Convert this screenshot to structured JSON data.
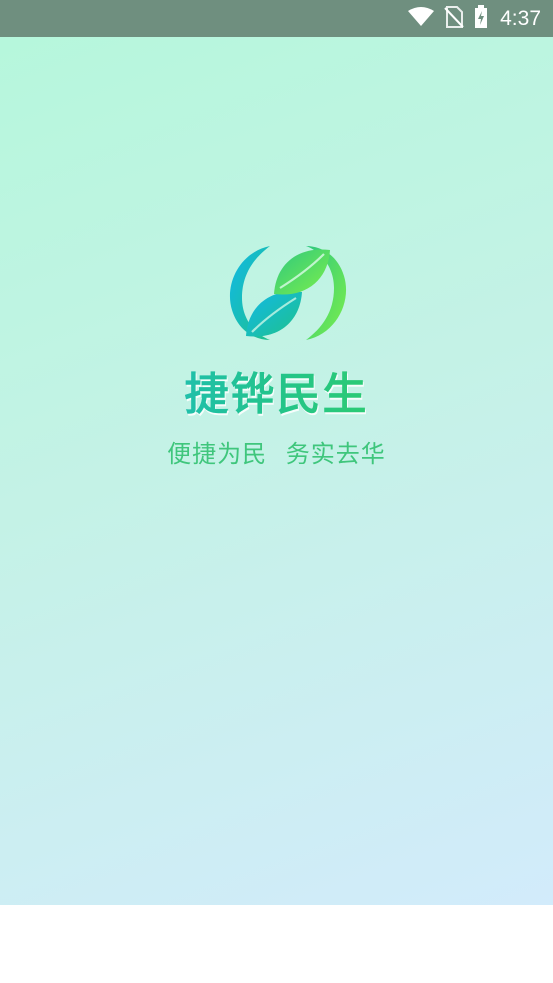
{
  "status_bar": {
    "time": "4:37",
    "icons": [
      "wifi-icon",
      "no-sim-icon",
      "battery-charging-icon"
    ]
  },
  "splash": {
    "title": "捷铧民生",
    "slogan": "便捷为民  务实去华",
    "logo_icon": "leaf-swirl-logo-icon"
  },
  "colors": {
    "status_bar_bg": "#6f8f7f",
    "gradient_top": "#b6f7dc",
    "gradient_bottom": "#d2ebfb",
    "title_blue": "#16b6ea",
    "title_green": "#3bd848",
    "slogan_green": "#3fc67c"
  }
}
